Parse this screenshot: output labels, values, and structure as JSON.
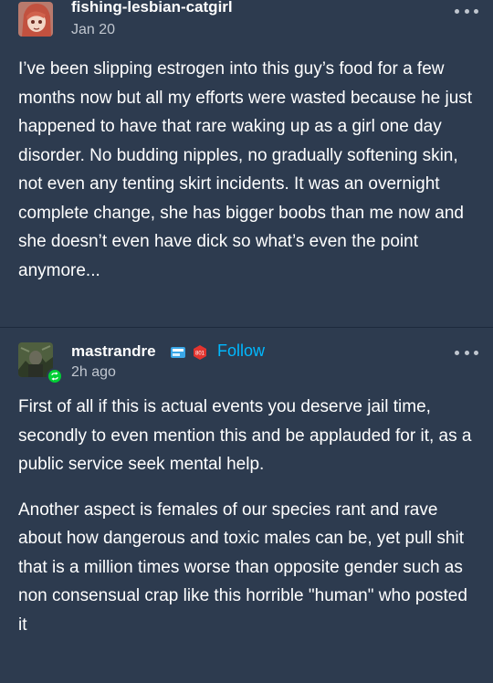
{
  "posts": [
    {
      "blog_name": "fishing-lesbian-catgirl",
      "timestamp": "Jan 20",
      "body": "I’ve been slipping estrogen into this guy’s food for a few months now but all my efforts were wasted because he just happened to have that rare waking up as a girl one day disorder. No budding nipples, no gradually softening skin, not even any tenting skirt incidents. It was an overnight complete change, she has bigger boobs than me now and she doesn’t even have dick so what’s even the point anymore..."
    },
    {
      "blog_name": "mastrandre",
      "follow_label": "Follow",
      "timestamp": "2h ago",
      "badge_b_text": "801",
      "paragraphs": [
        "First of all if this is actual events you deserve jail time, secondly to even mention this and be applauded for it, as a public service seek mental help.",
        "Another aspect is females of our species rant and rave about how dangerous and toxic males can be, yet pull shit that is a million times worse than opposite gender such as non consensual crap like this horrible \"human\" who posted it"
      ]
    }
  ],
  "colors": {
    "background": "#2d3b4f",
    "accent": "#00b8ff",
    "reblog_badge": "#00cf35",
    "secondary_text": "#c0c6cf"
  },
  "icons": {
    "more": "more-options-icon",
    "reblog": "reblog-icon",
    "badge_a": "badge-icon",
    "badge_b": "badge-icon"
  }
}
